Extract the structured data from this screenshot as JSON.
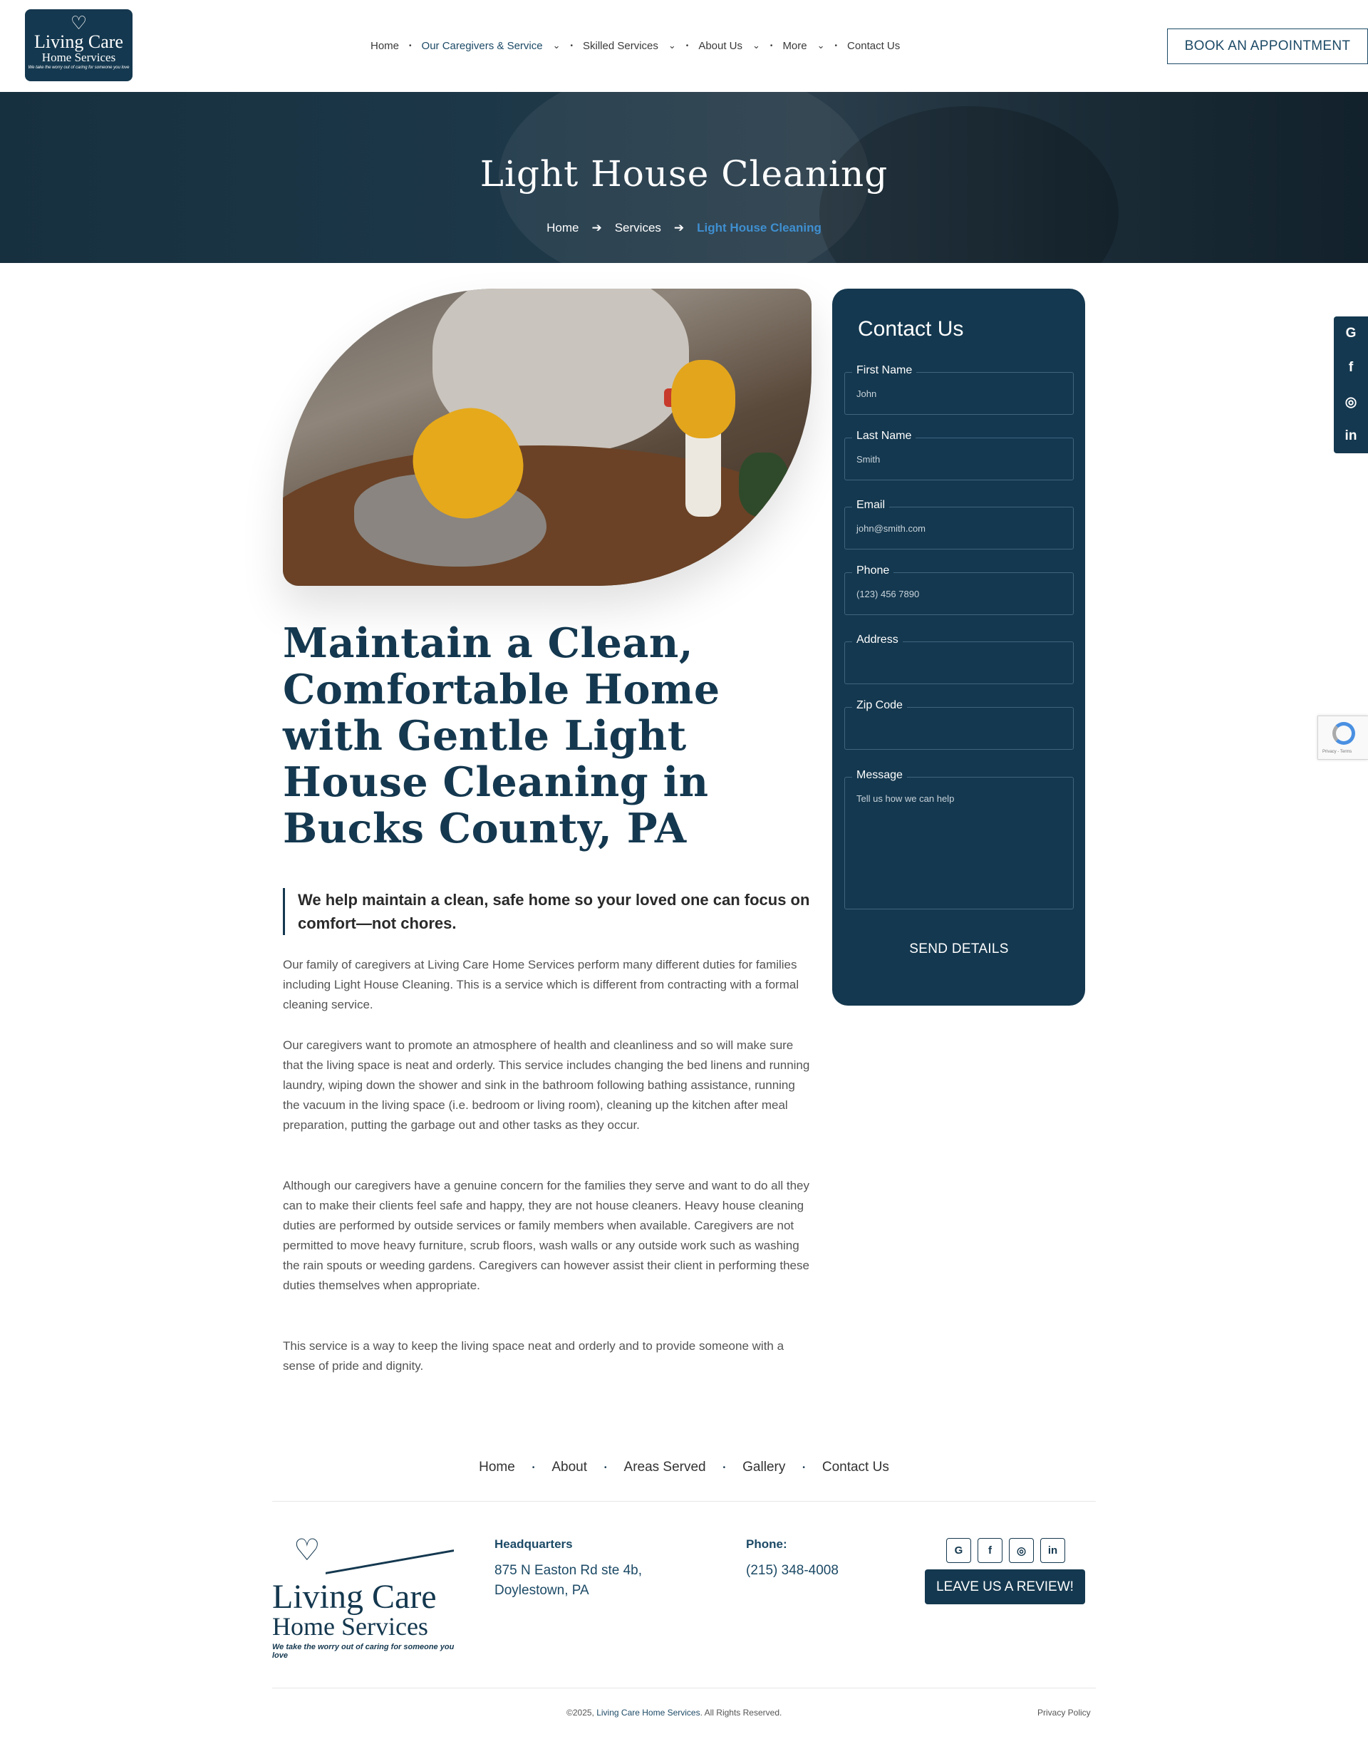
{
  "header": {
    "logo": {
      "line1": "Living Care",
      "line2": "Home Services",
      "tagline": "We take the worry out of caring for someone you love"
    },
    "nav": [
      {
        "label": "Home",
        "dropdown": false,
        "active": false
      },
      {
        "label": "Our Caregivers & Service",
        "dropdown": true,
        "active": true
      },
      {
        "label": "Skilled Services",
        "dropdown": true,
        "active": false
      },
      {
        "label": "About Us",
        "dropdown": true,
        "active": false
      },
      {
        "label": "More",
        "dropdown": true,
        "active": false
      },
      {
        "label": "Contact Us",
        "dropdown": false,
        "active": false
      }
    ],
    "book_button": "BOOK AN APPOINTMENT"
  },
  "hero": {
    "title": "Light House Cleaning",
    "breadcrumb": [
      "Home",
      "Services",
      "Light House Cleaning"
    ]
  },
  "main": {
    "heading": "Maintain a Clean, Comfortable Home with Gentle Light House Cleaning in Bucks County, PA",
    "quote": "We help maintain a clean, safe home so your loved one can focus on comfort—not chores.",
    "paragraphs": [
      "Our family of caregivers at Living Care Home Services perform many different duties for families including Light House Cleaning. This is a service which is different from contracting with a formal cleaning service.",
      "Our caregivers want to promote an atmosphere of health and cleanliness and so will make sure that the living space is neat and orderly. This service includes changing the bed linens and running laundry, wiping down the shower and sink in the bathroom following bathing assistance, running the vacuum in the living space (i.e. bedroom or living room), cleaning up the kitchen after meal preparation, putting the garbage out and other tasks as they occur.",
      "Although our caregivers have a genuine concern for the families they serve and want to do all they can to make their clients feel safe and happy, they are not house cleaners. Heavy house cleaning duties are performed by outside services or family members when available. Caregivers are not permitted to move heavy furniture, scrub floors, wash walls or any outside work such as washing the rain spouts or weeding gardens. Caregivers can however assist their client in performing these duties themselves when appropriate.",
      "This service is a way to keep the living space neat and orderly and to provide someone with a sense of pride and dignity."
    ]
  },
  "contact_form": {
    "title": "Contact Us",
    "fields": [
      {
        "label": "First Name",
        "placeholder": "John"
      },
      {
        "label": "Last Name",
        "placeholder": "Smith"
      },
      {
        "label": "Email",
        "placeholder": "john@smith.com"
      },
      {
        "label": "Phone",
        "placeholder": "(123) 456 7890"
      },
      {
        "label": "Address",
        "placeholder": ""
      },
      {
        "label": "Zip Code",
        "placeholder": ""
      },
      {
        "label": "Message",
        "placeholder": "Tell us how we can help"
      }
    ],
    "submit": "SEND DETAILS"
  },
  "side_social": [
    "G",
    "f",
    "◎",
    "in"
  ],
  "recaptcha": {
    "text": "Privacy - Terms"
  },
  "footer": {
    "nav": [
      "Home",
      "About",
      "Areas Served",
      "Gallery",
      "Contact Us"
    ],
    "logo": {
      "line1": "Living Care",
      "line2": "Home Services",
      "tagline": "We take the worry out of caring for someone you love"
    },
    "headquarters": {
      "heading": "Headquarters",
      "line1": "875 N Easton Rd ste 4b,",
      "line2": "Doylestown, PA"
    },
    "phone": {
      "heading": "Phone:",
      "number": "(215) 348-4008"
    },
    "social": [
      "G",
      "f",
      "◎",
      "in"
    ],
    "review_button": "LEAVE US A REVIEW!",
    "copyright_prefix": "©2025, ",
    "copyright_brand": "Living Care Home Services",
    "copyright_suffix": ". All Rights Reserved.",
    "privacy": "Privacy Policy"
  },
  "colors": {
    "navy": "#14384f",
    "accent_blue": "#3f8fd0",
    "text": "#555555"
  }
}
